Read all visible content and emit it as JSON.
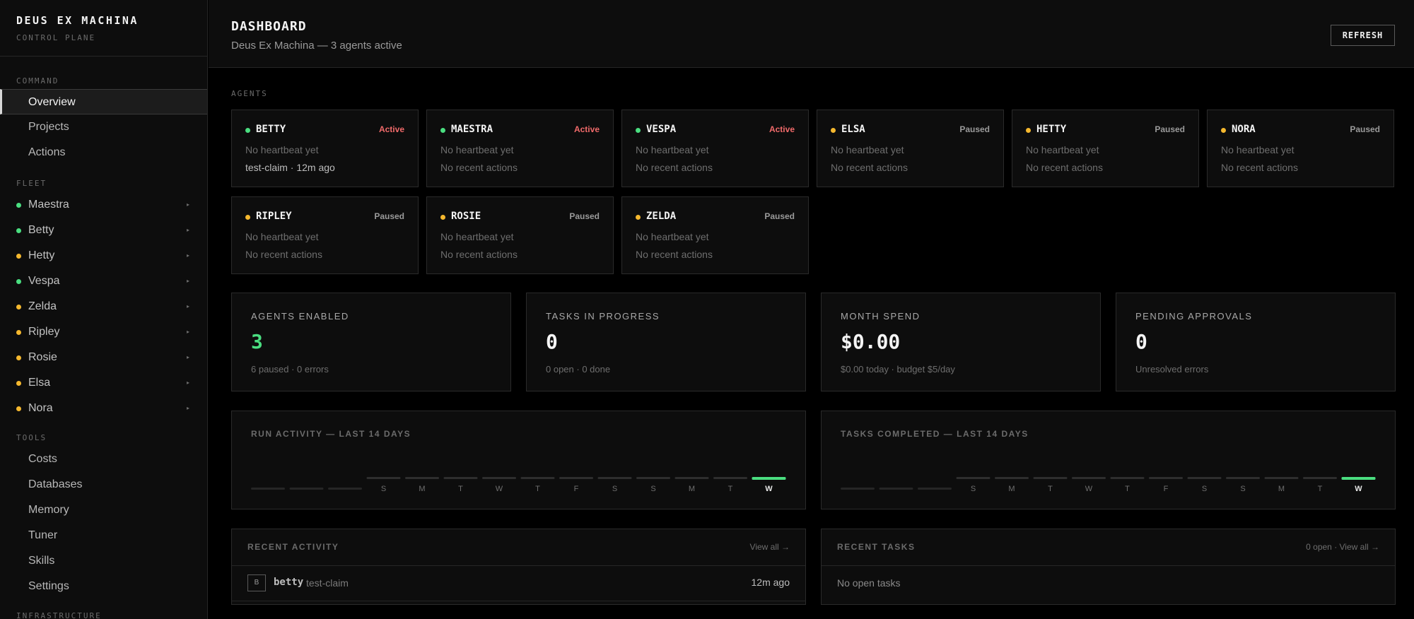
{
  "brand": {
    "title": "DEUS EX MACHINA",
    "subtitle": "CONTROL PLANE"
  },
  "sidebar": {
    "sections": {
      "command": "COMMAND",
      "fleet": "FLEET",
      "tools": "TOOLS",
      "infrastructure": "INFRASTRUCTURE"
    },
    "command_items": [
      {
        "label": "Overview",
        "active": true
      },
      {
        "label": "Projects"
      },
      {
        "label": "Actions"
      }
    ],
    "fleet_items": [
      {
        "label": "Maestra",
        "status": "active"
      },
      {
        "label": "Betty",
        "status": "active"
      },
      {
        "label": "Hetty",
        "status": "paused"
      },
      {
        "label": "Vespa",
        "status": "active"
      },
      {
        "label": "Zelda",
        "status": "paused"
      },
      {
        "label": "Ripley",
        "status": "paused"
      },
      {
        "label": "Rosie",
        "status": "paused"
      },
      {
        "label": "Elsa",
        "status": "paused"
      },
      {
        "label": "Nora",
        "status": "paused"
      }
    ],
    "fleet_caret": "▸",
    "tools_items": [
      {
        "label": "Costs"
      },
      {
        "label": "Databases"
      },
      {
        "label": "Memory"
      },
      {
        "label": "Tuner"
      },
      {
        "label": "Skills"
      },
      {
        "label": "Settings"
      }
    ]
  },
  "header": {
    "title": "DASHBOARD",
    "subtitle": "Deus Ex Machina — 3 agents active",
    "refresh_label": "REFRESH"
  },
  "agents": {
    "label": "AGENTS",
    "cards": [
      {
        "name": "BETTY",
        "status": "Active",
        "state": "active",
        "heartbeat": "No heartbeat yet",
        "recent": "test-claim · 12m ago",
        "has_recent": true
      },
      {
        "name": "MAESTRA",
        "status": "Active",
        "state": "active",
        "heartbeat": "No heartbeat yet",
        "recent": "No recent actions"
      },
      {
        "name": "VESPA",
        "status": "Active",
        "state": "active",
        "heartbeat": "No heartbeat yet",
        "recent": "No recent actions"
      },
      {
        "name": "ELSA",
        "status": "Paused",
        "state": "paused",
        "heartbeat": "No heartbeat yet",
        "recent": "No recent actions"
      },
      {
        "name": "HETTY",
        "status": "Paused",
        "state": "paused",
        "heartbeat": "No heartbeat yet",
        "recent": "No recent actions"
      },
      {
        "name": "NORA",
        "status": "Paused",
        "state": "paused",
        "heartbeat": "No heartbeat yet",
        "recent": "No recent actions"
      },
      {
        "name": "RIPLEY",
        "status": "Paused",
        "state": "paused",
        "heartbeat": "No heartbeat yet",
        "recent": "No recent actions"
      },
      {
        "name": "ROSIE",
        "status": "Paused",
        "state": "paused",
        "heartbeat": "No heartbeat yet",
        "recent": "No recent actions"
      },
      {
        "name": "ZELDA",
        "status": "Paused",
        "state": "paused",
        "heartbeat": "No heartbeat yet",
        "recent": "No recent actions"
      }
    ]
  },
  "stats": [
    {
      "label": "AGENTS ENABLED",
      "value": "3",
      "sub": "6 paused · 0 errors",
      "accent": true
    },
    {
      "label": "TASKS IN PROGRESS",
      "value": "0",
      "sub": "0 open · 0 done"
    },
    {
      "label": "MONTH SPEND",
      "value": "$0.00",
      "sub": "$0.00 today · budget $5/day"
    },
    {
      "label": "PENDING APPROVALS",
      "value": "0",
      "sub": "Unresolved errors"
    }
  ],
  "colors": {
    "active": "#4ade80",
    "paused": "#f5b82e",
    "active_status_text": "#f06a6a",
    "paused_status_text": "#9a9a9a",
    "bar_today": "#4ade80",
    "bar_empty": "#2e2e2e"
  },
  "chart_data": [
    {
      "type": "bar",
      "title": "RUN ACTIVITY — LAST 14 DAYS",
      "categories": [
        "",
        "",
        "",
        "S",
        "M",
        "T",
        "W",
        "T",
        "F",
        "S",
        "S",
        "M",
        "T",
        "W"
      ],
      "values": [
        0,
        0,
        0,
        0,
        0,
        0,
        0,
        0,
        0,
        0,
        0,
        0,
        0,
        1
      ],
      "highlight_last": true
    },
    {
      "type": "bar",
      "title": "TASKS COMPLETED — LAST 14 DAYS",
      "categories": [
        "",
        "",
        "",
        "S",
        "M",
        "T",
        "W",
        "T",
        "F",
        "S",
        "S",
        "M",
        "T",
        "W"
      ],
      "values": [
        0,
        0,
        0,
        0,
        0,
        0,
        0,
        0,
        0,
        0,
        0,
        0,
        0,
        1
      ],
      "highlight_last": true
    }
  ],
  "recent_activity": {
    "title": "RECENT ACTIVITY",
    "link": "View all →",
    "rows": [
      {
        "avatar": "B",
        "agent": "betty",
        "action": "test-claim",
        "time": "12m ago"
      }
    ]
  },
  "recent_tasks": {
    "title": "RECENT TASKS",
    "link": "0 open · View all →",
    "empty": "No open tasks"
  }
}
